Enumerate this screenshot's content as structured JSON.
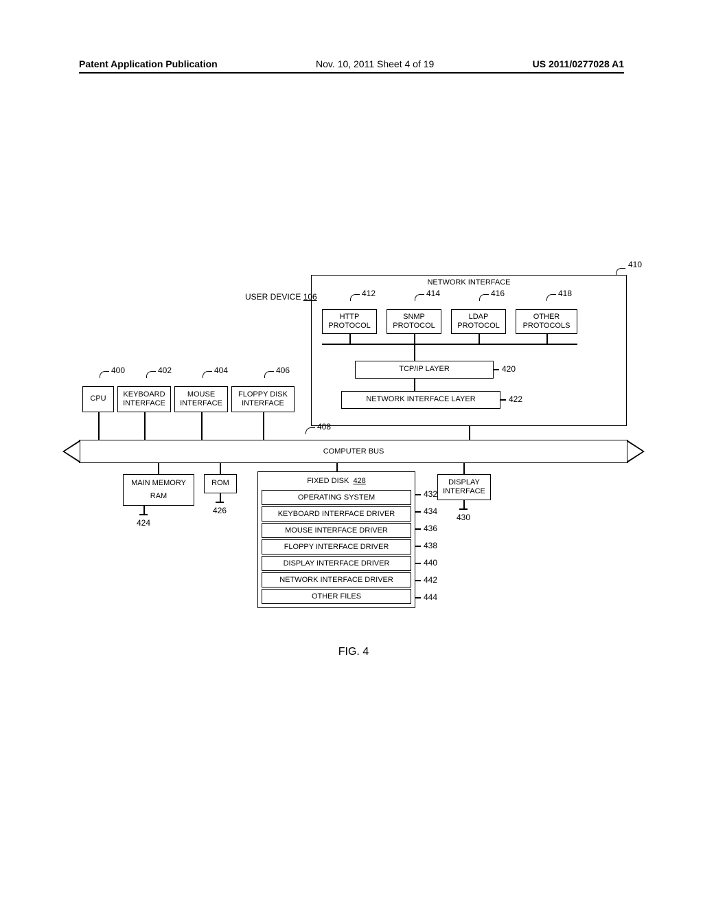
{
  "header": {
    "left": "Patent Application Publication",
    "center": "Nov. 10, 2011  Sheet 4 of 19",
    "right": "US 2011/0277028 A1"
  },
  "userDevice": {
    "label": "USER DEVICE",
    "num": "106"
  },
  "network": {
    "title": "NETWORK INTERFACE",
    "ref": "410",
    "protocols": [
      {
        "l1": "HTTP",
        "l2": "PROTOCOL",
        "ref": "412"
      },
      {
        "l1": "SNMP",
        "l2": "PROTOCOL",
        "ref": "414"
      },
      {
        "l1": "LDAP",
        "l2": "PROTOCOL",
        "ref": "416"
      },
      {
        "l1": "OTHER",
        "l2": "PROTOCOLS",
        "ref": "418"
      }
    ],
    "tcp": {
      "label": "TCP/IP LAYER",
      "ref": "420"
    },
    "nil": {
      "label": "NETWORK INTERFACE LAYER",
      "ref": "422"
    }
  },
  "topLeft": [
    {
      "label": "CPU",
      "ref": "400"
    },
    {
      "l1": "KEYBOARD",
      "l2": "INTERFACE",
      "ref": "402"
    },
    {
      "l1": "MOUSE",
      "l2": "INTERFACE",
      "ref": "404"
    },
    {
      "l1": "FLOPPY DISK",
      "l2": "INTERFACE",
      "ref": "406"
    }
  ],
  "bus": {
    "label": "COMPUTER BUS",
    "ref": "408"
  },
  "bottom": {
    "mainMem": {
      "l1": "MAIN MEMORY",
      "l2": "RAM",
      "ref": "424"
    },
    "rom": {
      "label": "ROM",
      "ref": "426"
    },
    "display": {
      "l1": "DISPLAY",
      "l2": "INTERFACE",
      "ref": "430"
    },
    "fixedDisk": {
      "title": "FIXED DISK",
      "num": "428",
      "items": [
        {
          "label": "OPERATING SYSTEM",
          "ref": "432"
        },
        {
          "label": "KEYBOARD INTERFACE DRIVER",
          "ref": "434"
        },
        {
          "label": "MOUSE INTERFACE DRIVER",
          "ref": "436"
        },
        {
          "label": "FLOPPY INTERFACE DRIVER",
          "ref": "438"
        },
        {
          "label": "DISPLAY INTERFACE DRIVER",
          "ref": "440"
        },
        {
          "label": "NETWORK INTERFACE DRIVER",
          "ref": "442"
        },
        {
          "label": "OTHER FILES",
          "ref": "444"
        }
      ]
    }
  },
  "figure": "FIG. 4"
}
